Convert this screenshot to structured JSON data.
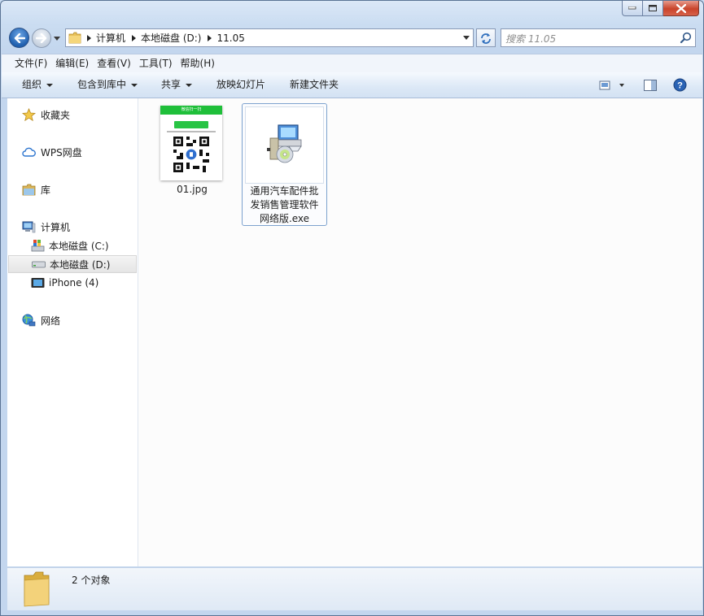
{
  "window": {
    "colors": {
      "frame": "#c3d6ee",
      "close": "#c9442b",
      "accent": "#1f5fae"
    }
  },
  "caption_buttons": {
    "minimize_icon": "minimize-icon",
    "maximize_icon": "maximize-icon",
    "close_icon": "close-icon"
  },
  "address": {
    "crumbs": [
      "计算机",
      "本地磁盘 (D:)",
      "11.05"
    ]
  },
  "search": {
    "placeholder": "搜索 11.05"
  },
  "menu": [
    "文件(F)",
    "编辑(E)",
    "查看(V)",
    "工具(T)",
    "帮助(H)"
  ],
  "toolbar": {
    "organize": "组织",
    "include_library": "包含到库中",
    "share": "共享",
    "slideshow": "放映幻灯片",
    "new_folder": "新建文件夹"
  },
  "nav": {
    "favorites": "收藏夹",
    "wps": "WPS网盘",
    "library": "库",
    "computer": "计算机",
    "drive_c": "本地磁盘 (C:)",
    "drive_d": "本地磁盘 (D:)",
    "iphone": "iPhone (4)",
    "network": "网络"
  },
  "files": [
    {
      "name": "01.jpg",
      "thumb_header": "微信扫一扫",
      "icon": "qr-image-icon"
    },
    {
      "name_lines": [
        "通用汽车配件批",
        "发销售管理软件",
        "网络版.exe"
      ],
      "icon": "installer-icon"
    }
  ],
  "status": {
    "count": "2 个对象"
  }
}
